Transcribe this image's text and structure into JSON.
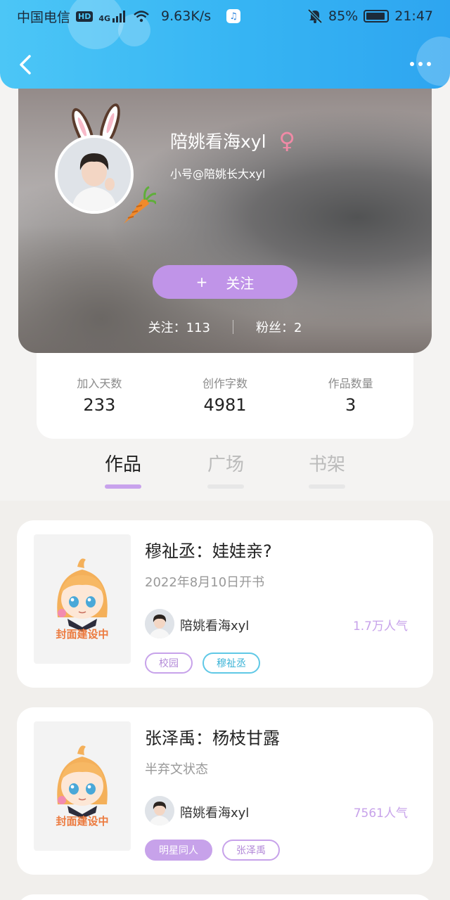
{
  "status_bar": {
    "carrier": "中国电信",
    "hd": "HD",
    "signal": "4G",
    "speed": "9.63K/s",
    "battery": "85%",
    "time": "21:47"
  },
  "nav": {
    "back_icon": "chevron-left-icon",
    "more_icon": "more-dots-icon"
  },
  "profile": {
    "username": "陪姚看海xyl",
    "gender_symbol": "♀",
    "subname": "小号@陪姚长大xyl",
    "follow_plus": "+",
    "follow_label": "关注",
    "following": "关注：113",
    "fans": "粉丝：2"
  },
  "stats": [
    {
      "label": "加入天数",
      "value": "233"
    },
    {
      "label": "创作字数",
      "value": "4981"
    },
    {
      "label": "作品数量",
      "value": "3"
    }
  ],
  "tabs": [
    {
      "label": "作品",
      "active": true
    },
    {
      "label": "广场",
      "active": false
    },
    {
      "label": "书架",
      "active": false
    }
  ],
  "books": [
    {
      "cover_label": "封面建设中",
      "title": "穆祉丞：娃娃亲?",
      "subtitle": "2022年8月10日开书",
      "author": "陪姚看海xyl",
      "popularity": "1.7万人气",
      "tags": [
        "校园",
        "穆祉丞"
      ]
    },
    {
      "cover_label": "封面建设中",
      "title": "张泽禹：杨枝甘露",
      "subtitle": "半弃文状态",
      "author": "陪姚看海xyl",
      "popularity": "7561人气",
      "tags": [
        "明星同人",
        "张泽禹"
      ]
    }
  ],
  "colors": {
    "header": "#36b4f3",
    "accent_purple": "#c094e8",
    "tag_blue": "#5fc8e6",
    "cover_text": "#ec7a3e"
  }
}
